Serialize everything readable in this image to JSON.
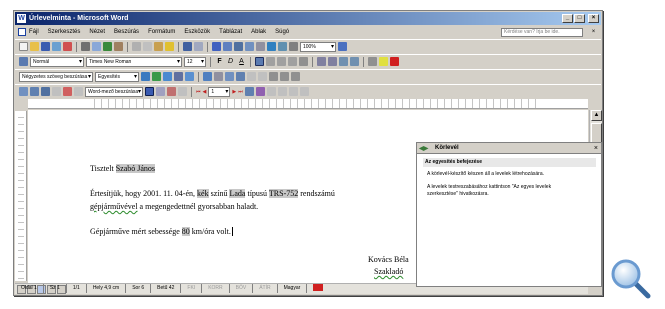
{
  "window": {
    "title": "Úrlevelminta - Microsoft Word"
  },
  "menu": {
    "items": [
      "Fájl",
      "Szerkesztés",
      "Nézet",
      "Beszúrás",
      "Formátum",
      "Eszközök",
      "Táblázat",
      "Ablak",
      "Súgó"
    ],
    "help_placeholder": "Kérdése van? Írja be ide."
  },
  "toolbar1": {
    "zoom": "100%"
  },
  "toolbar2": {
    "style": "Normál",
    "font": "Times New Roman",
    "size": "12"
  },
  "toolbar3": {
    "mail_merge_insert": "Négyzetes szöveg beszúrása",
    "merge_fields": "Egyesítés"
  },
  "toolbar4": {
    "word_field": "Word-mező beszúrása",
    "record": "1"
  },
  "document": {
    "line1_prefix": "Tisztelt",
    "line1_field": "Szabó János",
    "line2_p1": "Értesítjük, hogy 2001. 11. 04-én,",
    "line2_field1": "kék",
    "line2_p2": "színű",
    "line2_field2": "Lada",
    "line2_p3": "típusú",
    "line2_field3": "TRS-752",
    "line2_p4": "rendszámú",
    "line3_p1": "gépjárművével",
    "line3_p2": "a megengedettnél gyorsabban haladt.",
    "line4_p1": "Gépjárműve mért sebessége",
    "line4_field": "80",
    "line4_p2": "km/óra volt.",
    "signature_name": "Kovács Béla",
    "signature_title": "Szakladó"
  },
  "task_pane": {
    "title": "Körlevél",
    "heading": "Az egyesítés befejezése",
    "para1": "A körlevél-készítő készen áll a levelek létrehozására.",
    "para2": "A levelek testreszabásához kattintson \"Az egyes levelek szerkesztése\" hivatkozásra."
  },
  "statusbar": {
    "page": "Oldal 1",
    "section": "Sz 1",
    "pages": "1/1",
    "position": "Hely 4,9 cm",
    "line": "Sor 6",
    "column": "Betű 42",
    "rec": "FKI",
    "trk": "KORR",
    "ext": "BŐV",
    "ovr": "ÁTÍR",
    "language": "Magyar"
  },
  "colors": {
    "titlebar_start": "#0a246a",
    "titlebar_end": "#a6caf0",
    "chrome": "#d4d0c8",
    "field_highlight": "#c8c8c8"
  }
}
